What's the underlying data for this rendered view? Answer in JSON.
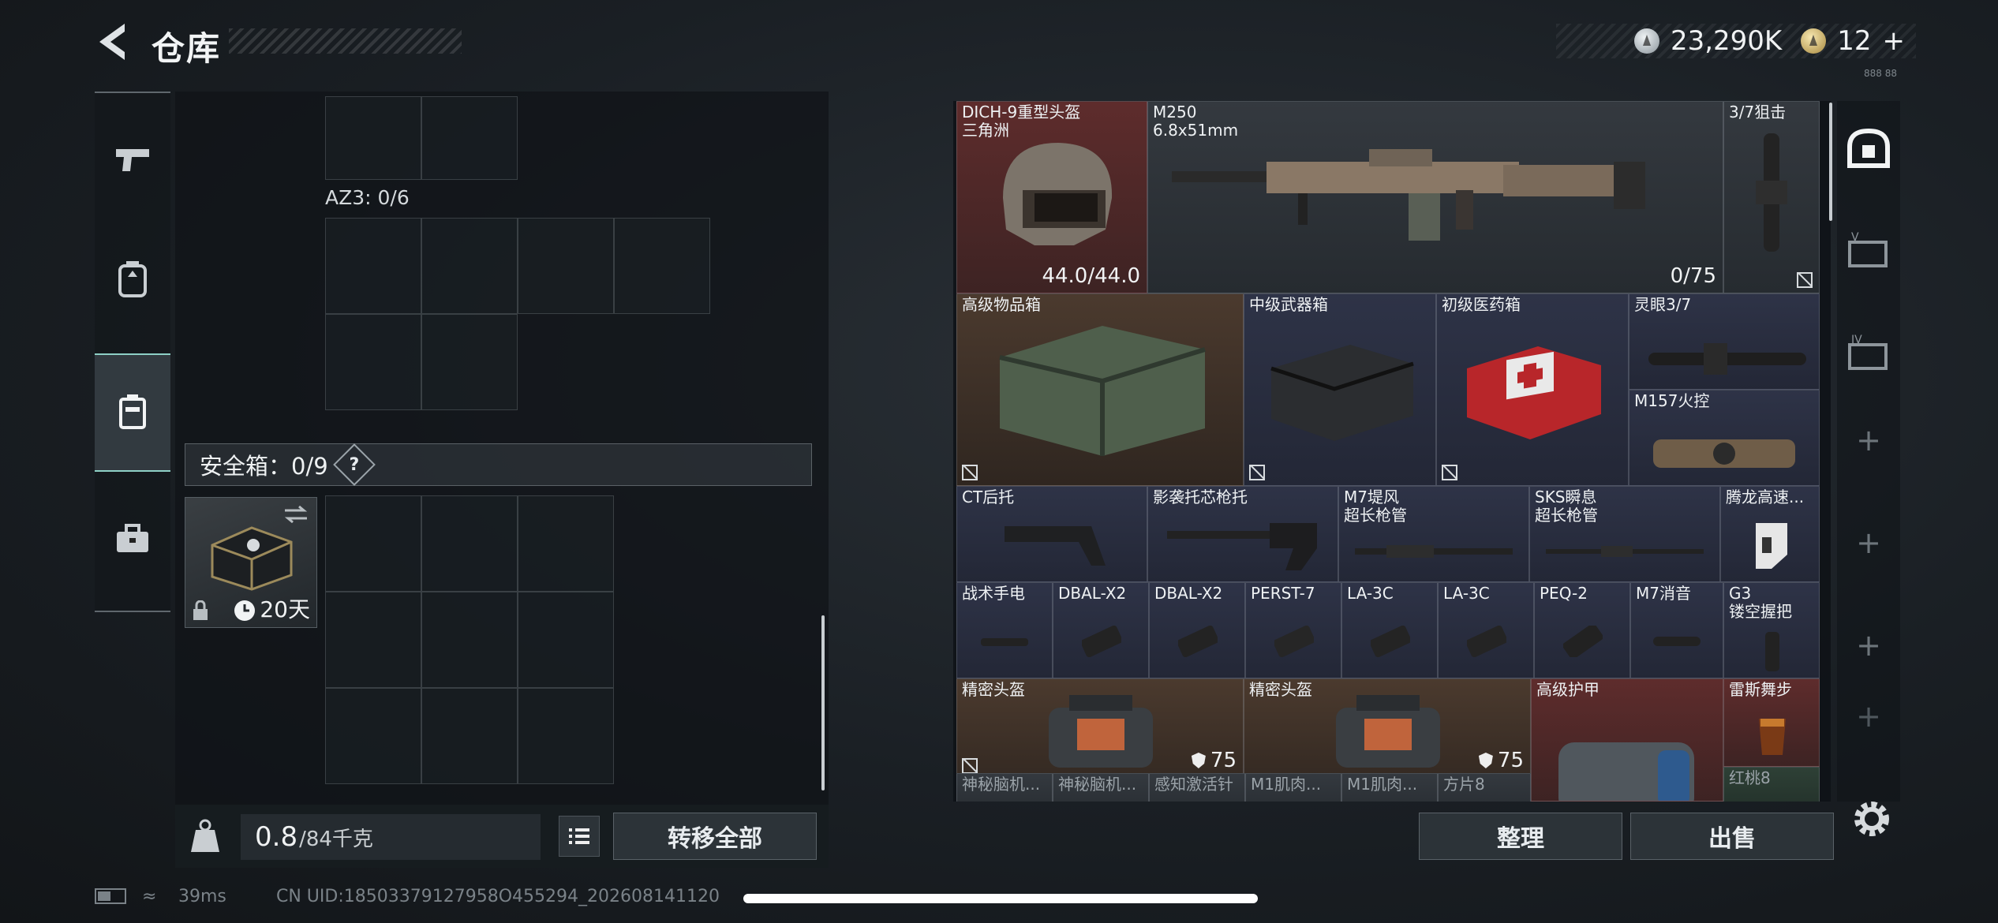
{
  "header": {
    "title": "仓库",
    "silver_amount": "23,290K",
    "gold_amount": "12",
    "gold_plus": "+",
    "tiny_tag": "888 88"
  },
  "left_nav": {
    "items": [
      {
        "name": "weapons",
        "icon": "pistol-icon"
      },
      {
        "name": "armor",
        "icon": "backpack-icon"
      },
      {
        "name": "storage",
        "icon": "vest-icon",
        "active": true
      },
      {
        "name": "toolbox",
        "icon": "toolbox-icon"
      }
    ]
  },
  "left_panel": {
    "az3_label": "AZ3: 0/6",
    "safe_label": "安全箱：0/9",
    "help_symbol": "?",
    "case_days": "20天",
    "weight_value": "0.8",
    "weight_unit": "/84千克",
    "transfer_all": "转移全部"
  },
  "stash": {
    "items": [
      {
        "name": "DICH-9重型头盔\n三角洲",
        "value": "44.0/44.0",
        "color": "red"
      },
      {
        "name": "M250\n6.8x51mm",
        "value": "0/75",
        "color": "gray"
      },
      {
        "name": "3/7狙击",
        "color": "gray"
      },
      {
        "name": "高级物品箱",
        "color": "brown"
      },
      {
        "name": "中级武器箱",
        "color": "blue"
      },
      {
        "name": "初级医药箱",
        "color": "blue"
      },
      {
        "name": "灵眼3/7",
        "color": "blue"
      },
      {
        "name": "M157火控",
        "color": "blue"
      },
      {
        "name": "CT后托",
        "color": "blue"
      },
      {
        "name": "影袭托芯枪托",
        "color": "blue"
      },
      {
        "name": "M7堤风\n超长枪管",
        "color": "blue"
      },
      {
        "name": "SKS瞬息\n超长枪管",
        "color": "blue"
      },
      {
        "name": "腾龙高速...",
        "color": "blue"
      },
      {
        "name": "战术手电",
        "color": "blue"
      },
      {
        "name": "DBAL-X2",
        "color": "blue"
      },
      {
        "name": "DBAL-X2",
        "color": "blue"
      },
      {
        "name": "PERST-7",
        "color": "blue"
      },
      {
        "name": "LA-3C",
        "color": "blue"
      },
      {
        "name": "LA-3C",
        "color": "blue"
      },
      {
        "name": "PEQ-2",
        "color": "blue"
      },
      {
        "name": "M7消音",
        "color": "blue"
      },
      {
        "name": "G3\n镂空握把",
        "color": "blue"
      },
      {
        "name": "精密头盔",
        "value": "75",
        "color": "brown"
      },
      {
        "name": "精密头盔",
        "value": "75",
        "color": "brown"
      },
      {
        "name": "高级护甲",
        "color": "red"
      },
      {
        "name": "雷斯舞步",
        "color": "red"
      },
      {
        "name": "神秘脑机...",
        "color": "gray"
      },
      {
        "name": "神秘脑机...",
        "color": "gray"
      },
      {
        "name": "感知激活针",
        "color": "gray"
      },
      {
        "name": "M1肌肉...",
        "color": "gray"
      },
      {
        "name": "M1肌肉...",
        "color": "gray"
      },
      {
        "name": "方片8",
        "color": "gray"
      },
      {
        "name": "红桃8",
        "color": "green"
      }
    ],
    "sort_button": "整理",
    "sell_button": "出售"
  },
  "right_rail": {
    "items": [
      "safebox-icon",
      "v-case-icon",
      "iv-case-icon",
      "+",
      "+",
      "+",
      "+"
    ]
  },
  "status_bar": {
    "ping": "39ms",
    "uid": "CN UID:18503379127958O455294_202608141120"
  },
  "colors": {
    "accent": "#8ed0c6",
    "red_rarity": "#5e2c2c",
    "blue_rarity": "#2e3347",
    "brown_rarity": "#4b3a2e"
  }
}
